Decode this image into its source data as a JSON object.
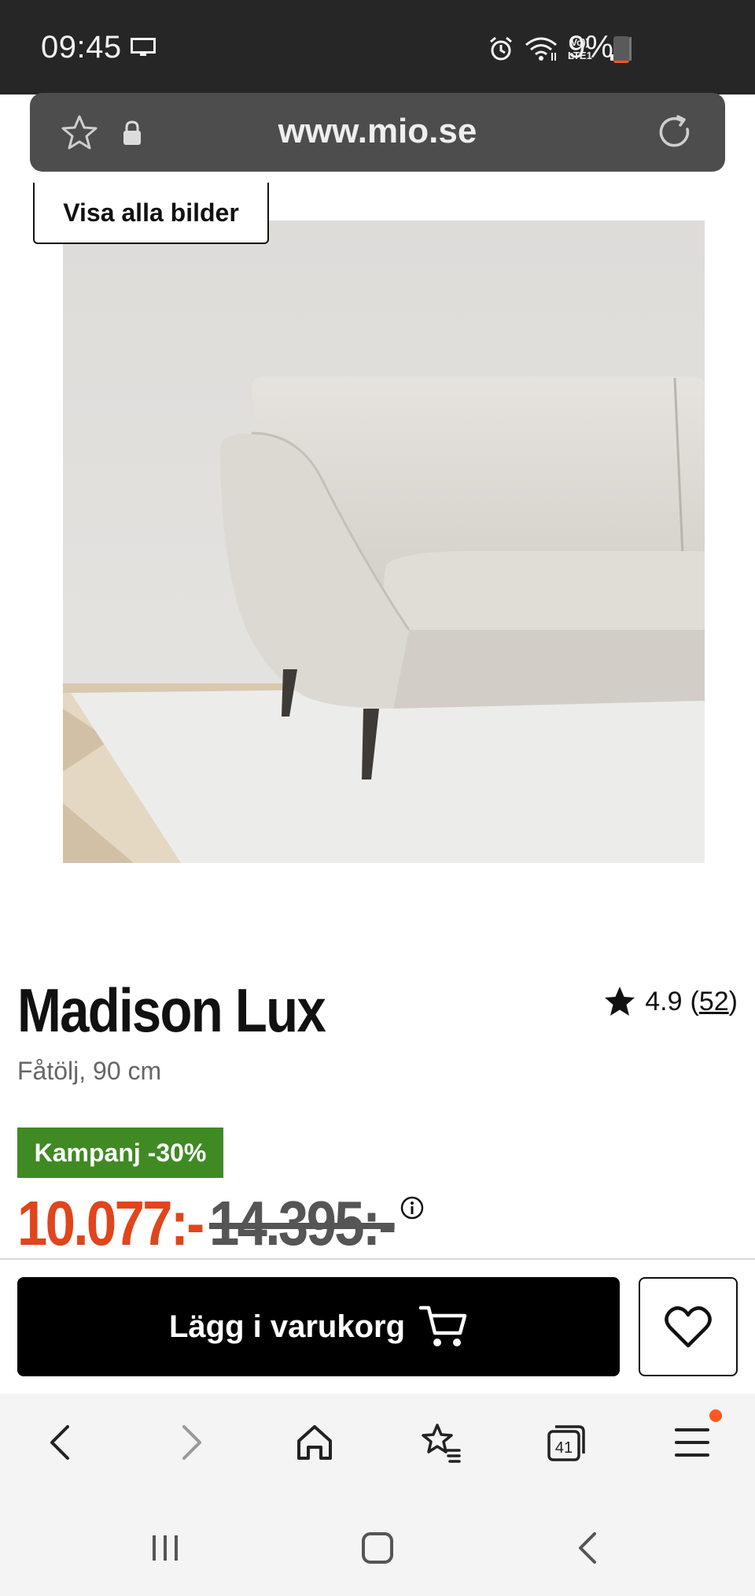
{
  "status_bar": {
    "time": "09:45",
    "battery": "9%",
    "battery_level": 0.09,
    "network": "LTE1",
    "icons": [
      "screen-cast-icon",
      "alarm-icon",
      "wifi-icon",
      "volte-icon",
      "signal-icon",
      "battery-icon"
    ]
  },
  "browser": {
    "url": "www.mio.se",
    "tab_count": "41",
    "accent_color": "#ff5722"
  },
  "gallery": {
    "show_all_label": "Visa alla bilder"
  },
  "product": {
    "title": "Madison Lux",
    "subtitle": "Fåtölj, 90 cm",
    "rating": "4.9",
    "rating_open": "(",
    "review_count": "52",
    "rating_close": ")",
    "campaign_badge": "Kampanj -30%",
    "price": "10.077:-",
    "old_price": "14.395:-",
    "price_color": "#e0451c",
    "badge_color": "#3f8a23"
  },
  "actions": {
    "add_to_cart": "Lägg i varukorg"
  }
}
